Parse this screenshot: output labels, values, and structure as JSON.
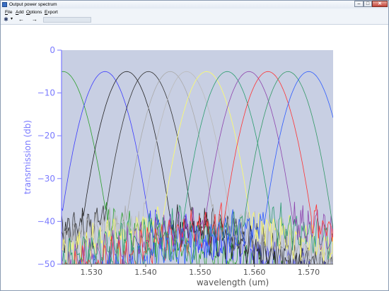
{
  "window": {
    "title": "Output power spectrum"
  },
  "menu": [
    "File",
    "Add",
    "Options",
    "Export"
  ],
  "toolbar": {
    "pin": "✱",
    "dropdown": "▾",
    "back": "←",
    "forward": "→"
  },
  "window_buttons": {
    "min": "–",
    "max": "□",
    "close": "✕"
  },
  "chart_data": {
    "type": "line",
    "title": "",
    "xlabel": "wavelength (um)",
    "ylabel": "transmission (db)",
    "xlim": [
      1.5245,
      1.5745
    ],
    "ylim": [
      -50,
      0
    ],
    "xticks": [
      "1.530",
      "1.540",
      "1.550",
      "1.560",
      "1.570"
    ],
    "xtick_values": [
      1.53,
      1.54,
      1.55,
      1.56,
      1.57
    ],
    "yticks": [
      "0",
      "−10",
      "−20",
      "−30",
      "−40",
      "−50"
    ],
    "ytick_values": [
      0,
      -10,
      -20,
      -30,
      -40,
      -50
    ],
    "grid": false,
    "legend": "none",
    "plot_background": "#c8cfe3",
    "axis_color": "#7a7aff",
    "peak_db": -5,
    "series": [
      {
        "color": "#2ca02c",
        "center": 1.5248
      },
      {
        "color": "#3b3bff",
        "center": 1.5325
      },
      {
        "color": "#222222",
        "center": 1.5365
      },
      {
        "color": "#333333",
        "center": 1.5405
      },
      {
        "color": "#aaaaaa",
        "center": 1.5445
      },
      {
        "color": "#bbbbbb",
        "center": 1.5475
      },
      {
        "color": "#ffff66",
        "center": 1.5512
      },
      {
        "color": "#2a9d6f",
        "center": 1.555
      },
      {
        "color": "#8e44ad",
        "center": 1.559
      },
      {
        "color": "#ff3333",
        "center": 1.5625
      },
      {
        "color": "#339966",
        "center": 1.5662
      },
      {
        "color": "#2e5cff",
        "center": 1.57
      }
    ]
  }
}
